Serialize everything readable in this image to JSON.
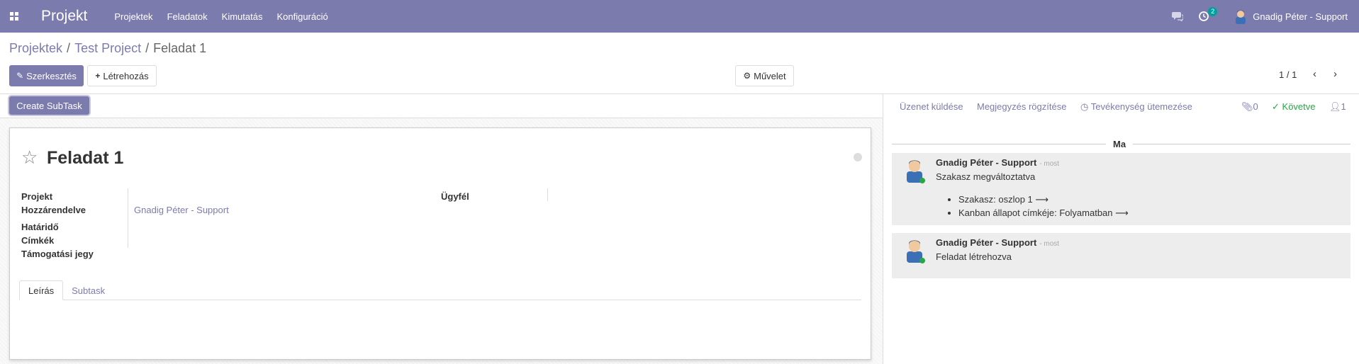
{
  "navbar": {
    "app_name": "Projekt",
    "menu": [
      "Projektek",
      "Feladatok",
      "Kimutatás",
      "Konfiguráció"
    ],
    "activity_badge": "2",
    "user_name": "Gnadig Péter - Support",
    "bg_color": "#7c7bad"
  },
  "breadcrumb": {
    "items": [
      "Projektek",
      "Test Project",
      "Feladat 1"
    ],
    "separator": "/"
  },
  "toolbar": {
    "edit_label": "Szerkesztés",
    "create_label": "Létrehozás",
    "action_label": "Művelet",
    "pager": "1 / 1",
    "prev_icon": "chevron-left-icon",
    "next_icon": "chevron-right-icon"
  },
  "statusbar": {
    "create_subtask_label": "Create SubTask"
  },
  "form": {
    "title": "Feladat 1",
    "fields": {
      "project_label": "Projekt",
      "project_value": "",
      "customer_label": "Ügyfél",
      "customer_value": "",
      "assigned_label": "Hozzárendelve",
      "assigned_value": "Gnadig Péter - Support",
      "deadline_label": "Határidő",
      "tags_label": "Címkék",
      "ticket_label": "Támogatási jegy"
    },
    "tabs": [
      "Leírás",
      "Subtask"
    ],
    "active_tab": "Leírás"
  },
  "chatter": {
    "send_message": "Üzenet küldése",
    "log_note": "Megjegyzés rögzítése",
    "schedule_activity": "Tevékenység ütemezése",
    "attachments_count": "0",
    "following_label": "Követve",
    "followers_count": "1",
    "date_separator": "Ma",
    "messages": [
      {
        "author": "Gnadig Péter - Support",
        "time": "- most",
        "body": "Szakasz megváltoztatva",
        "tracking": [
          "Szakasz: oszlop 1 ⟶",
          "Kanban állapot címkéje: Folyamatban ⟶"
        ]
      },
      {
        "author": "Gnadig Péter - Support",
        "time": "- most",
        "body": "Feladat létrehozva",
        "tracking": []
      }
    ]
  }
}
